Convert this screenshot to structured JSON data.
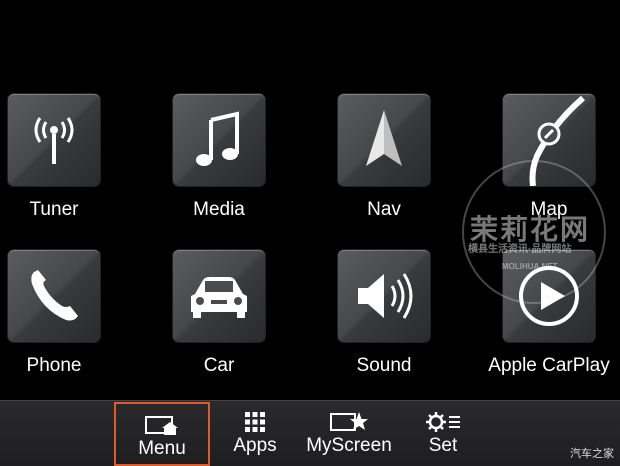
{
  "apps": [
    {
      "id": "tuner",
      "label": "Tuner",
      "icon": "radio-antenna-icon"
    },
    {
      "id": "media",
      "label": "Media",
      "icon": "music-note-icon"
    },
    {
      "id": "nav",
      "label": "Nav",
      "icon": "navigation-arrow-icon"
    },
    {
      "id": "map",
      "label": "Map",
      "icon": "map-route-icon"
    },
    {
      "id": "phone",
      "label": "Phone",
      "icon": "phone-handset-icon"
    },
    {
      "id": "car",
      "label": "Car",
      "icon": "car-icon"
    },
    {
      "id": "sound",
      "label": "Sound",
      "icon": "speaker-icon"
    },
    {
      "id": "carplay",
      "label": "Apple CarPlay",
      "icon": "play-icon"
    }
  ],
  "bottom_bar": {
    "menu_label": "Menu",
    "apps_label": "Apps",
    "myscreen_label": "MyScreen",
    "set_label": "Set",
    "highlight_color": "#e05a2b"
  },
  "watermark": {
    "title": "茉莉花网",
    "subtitle": "横县生活资讯·品牌网站",
    "url": "MOLIHUA.NET"
  },
  "corner_text": "汽车之家"
}
